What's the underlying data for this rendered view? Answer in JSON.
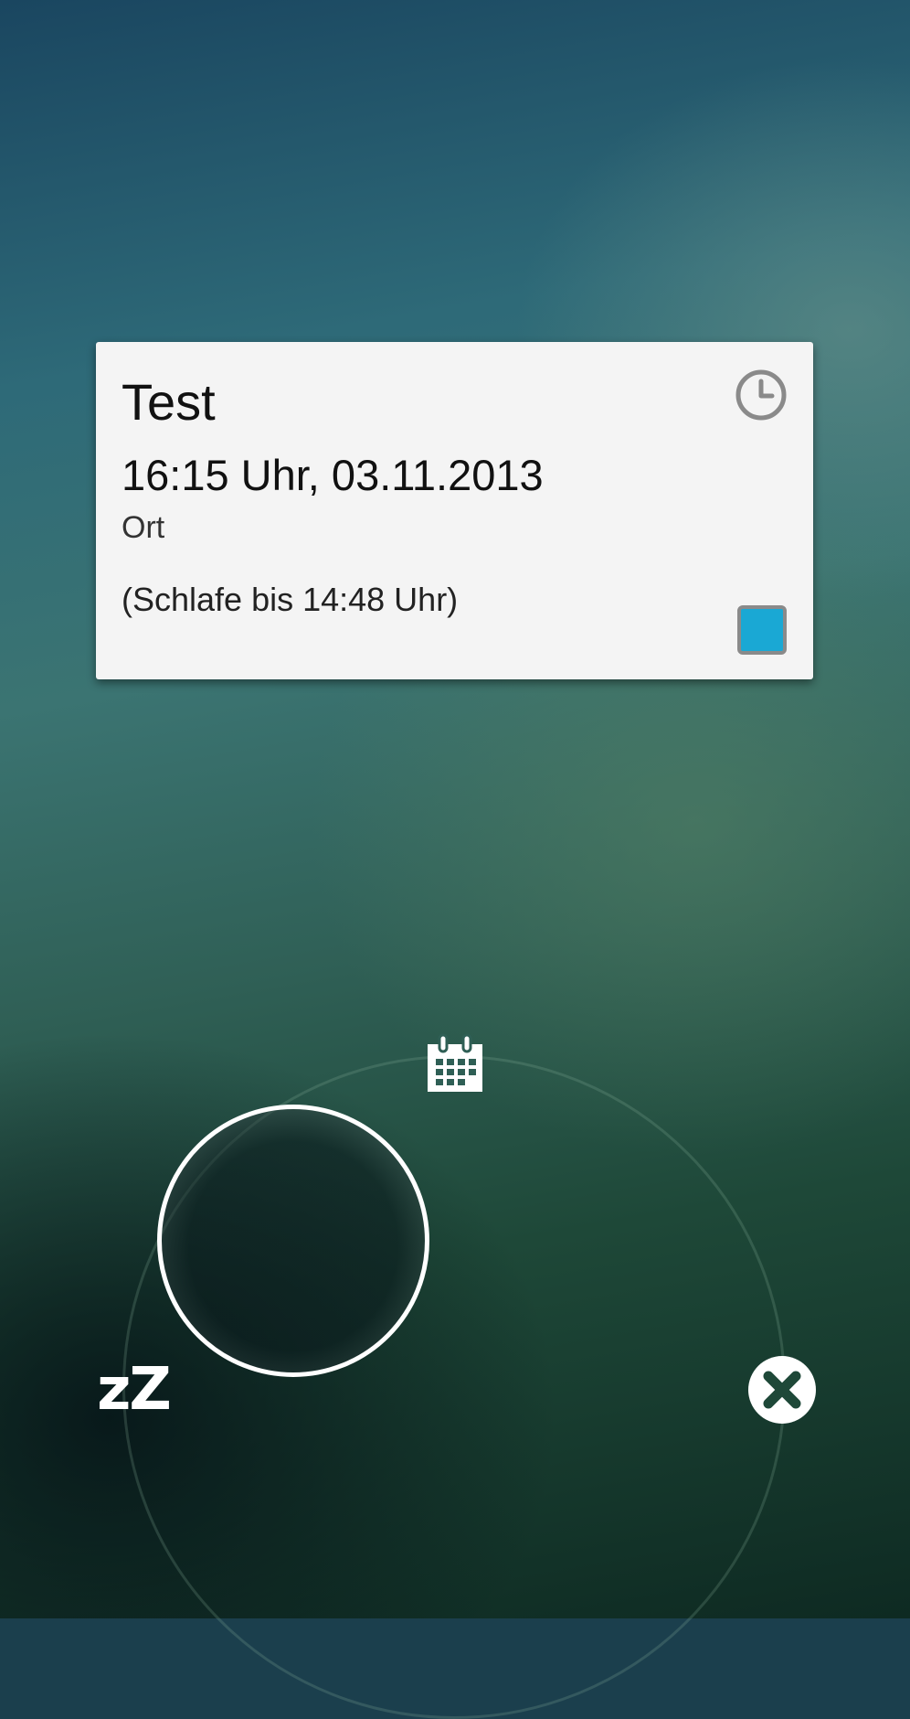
{
  "event_card": {
    "title": "Test",
    "datetime": "16:15 Uhr, 03.11.2013",
    "location": "Ort",
    "snooze_note": "(Schlafe bis 14:48 Uhr)",
    "clock_icon": "clock-icon",
    "color": "#1aa8d4"
  },
  "selector": {
    "top_target_icon": "calendar-icon",
    "left_target_label": "zZ",
    "right_target_icon": "close-icon"
  }
}
